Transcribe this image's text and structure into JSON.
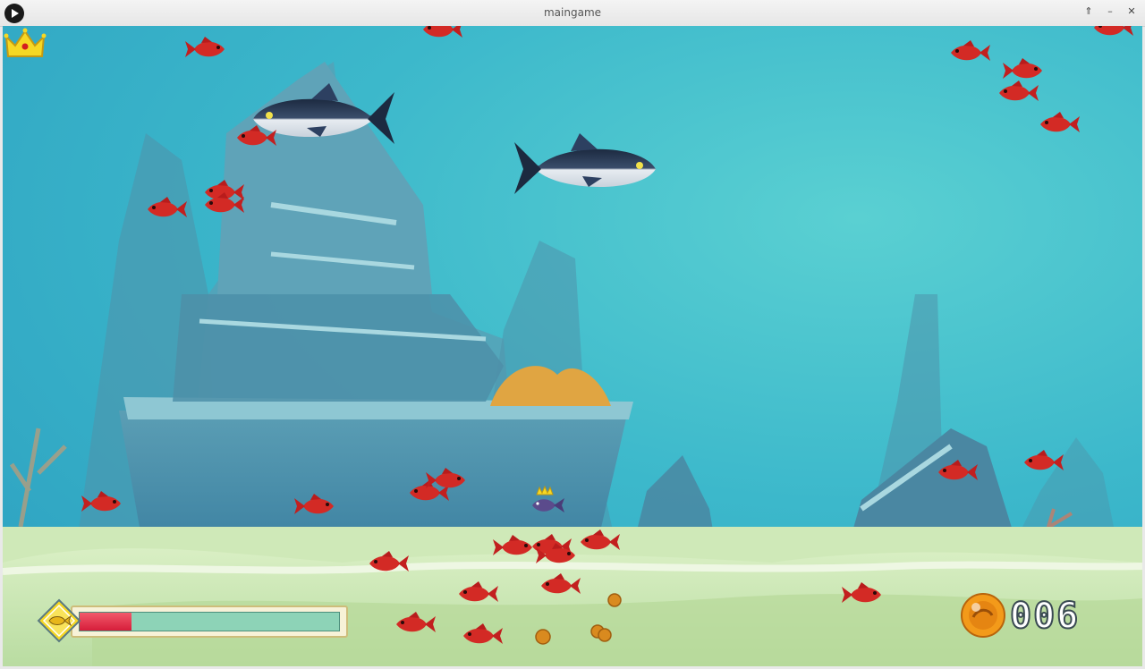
{
  "window": {
    "title": "maingame"
  },
  "controls": {
    "maximize_icon": "maximize-icon",
    "minimize_icon": "minimize-icon",
    "close_icon": "close-icon"
  },
  "hud": {
    "growth_progress": 0.2,
    "score": "006",
    "crown_icon": "crown-icon",
    "growth_icon": "fish-growth-icon",
    "pearl_icon": "pearl-icon"
  },
  "colors": {
    "water": "#3cb8cb",
    "sand": "#cde8b4",
    "enemy_red": "#d62828",
    "tuna": "#1f2e45"
  }
}
